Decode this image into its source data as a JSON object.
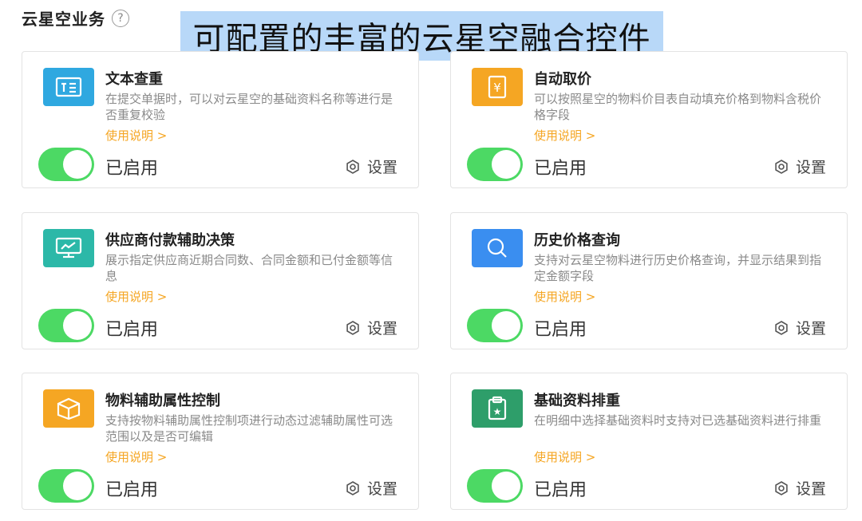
{
  "section": {
    "title": "云星空业务",
    "help_symbol": "?"
  },
  "banner": {
    "text": "可配置的丰富的云星空融合控件"
  },
  "colors": {
    "teal": "#2cb8a8",
    "orange": "#f5a623",
    "blue": "#3a8ef0",
    "sky": "#2fa8e0",
    "green": "#2e9e6a",
    "toggle_on": "#4cd964",
    "link": "#f5a623"
  },
  "cards": [
    {
      "icon": "text-check-icon",
      "title": "文本查重",
      "desc": "在提交单据时，可以对云星空的基础资料名称等进行是否重复校验",
      "help_link": "使用说明 >",
      "status": "已启用",
      "settings": "设置",
      "enabled": true
    },
    {
      "icon": "price-tag-icon",
      "title": "自动取价",
      "desc": "可以按照星空的物料价目表自动填充价格到物料含税价格字段",
      "help_link": "使用说明 >",
      "status": "已启用",
      "settings": "设置",
      "enabled": true
    },
    {
      "icon": "monitor-chart-icon",
      "title": "供应商付款辅助决策",
      "desc": "展示指定供应商近期合同数、合同金额和已付金额等信息",
      "help_link": "使用说明 >",
      "status": "已启用",
      "settings": "设置",
      "enabled": true
    },
    {
      "icon": "search-icon",
      "title": "历史价格查询",
      "desc": "支持对云星空物料进行历史价格查询，并显示结果到指定金额字段",
      "help_link": "使用说明 >",
      "status": "已启用",
      "settings": "设置",
      "enabled": true
    },
    {
      "icon": "box-icon",
      "title": "物料辅助属性控制",
      "desc": "支持按物料辅助属性控制项进行动态过滤辅助属性可选范围以及是否可编辑",
      "help_link": "使用说明 >",
      "status": "已启用",
      "settings": "设置",
      "enabled": true
    },
    {
      "icon": "clipboard-star-icon",
      "title": "基础资料排重",
      "desc": "在明细中选择基础资料时支持对已选基础资料进行排重",
      "help_link": "使用说明 >",
      "status": "已启用",
      "settings": "设置",
      "enabled": true
    }
  ]
}
